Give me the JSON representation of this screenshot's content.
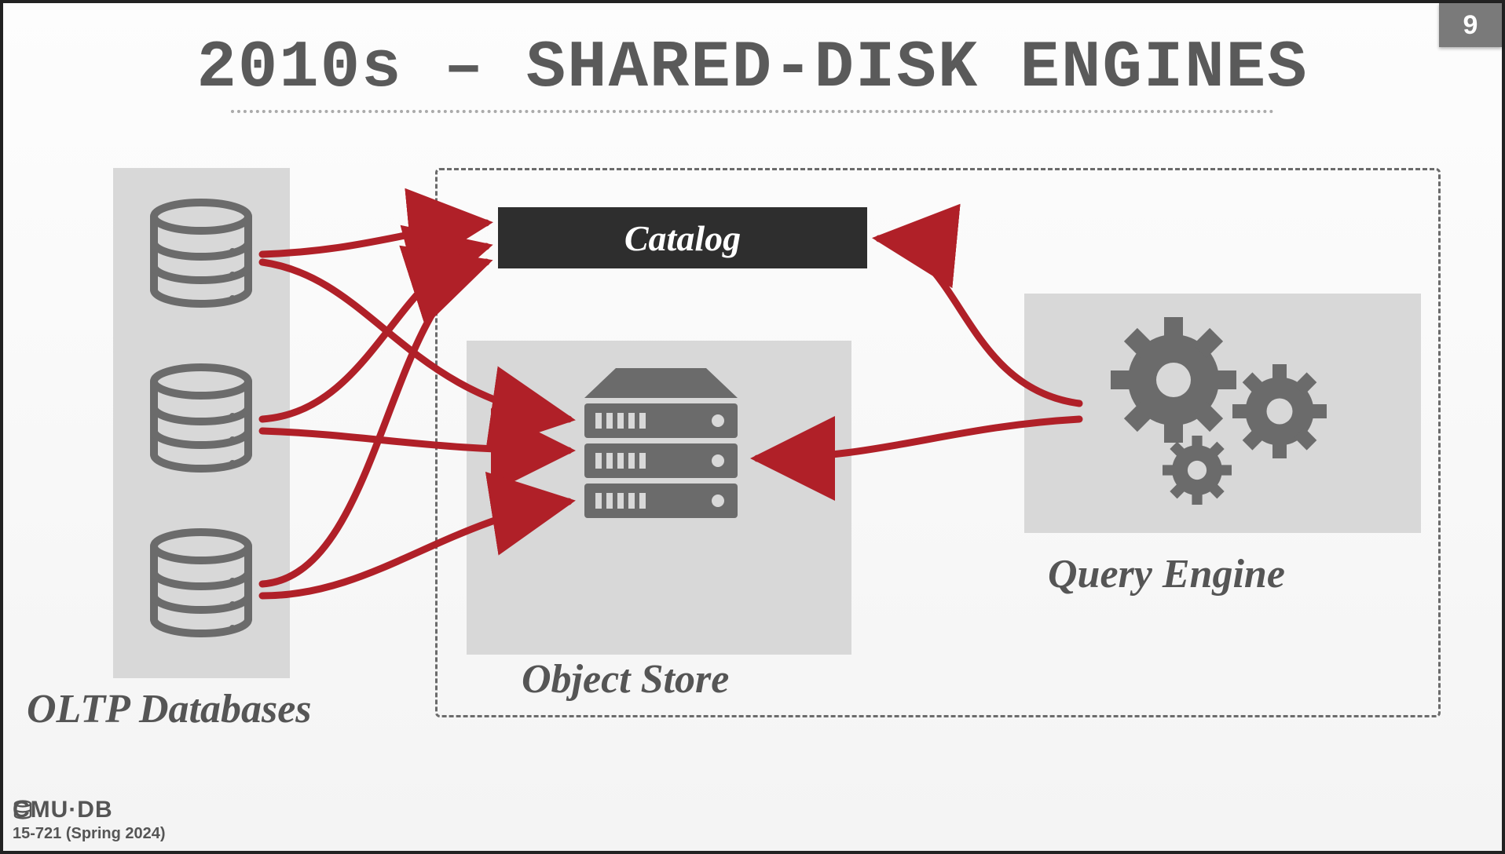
{
  "slide": {
    "title": "2010s – SHARED-DISK ENGINES",
    "page_number": "9"
  },
  "components": {
    "oltp_label": "OLTP Databases",
    "catalog_label": "Catalog",
    "object_store_label": "Object Store",
    "query_engine_label": "Query Engine"
  },
  "footer": {
    "logo_text": "CMU·DB",
    "course": "15-721 (Spring 2024)"
  },
  "colors": {
    "arrow": "#b02028",
    "grey_fill": "#d8d8d8",
    "icon_grey": "#6b6b6b",
    "catalog_bg": "#2e2e2e"
  }
}
